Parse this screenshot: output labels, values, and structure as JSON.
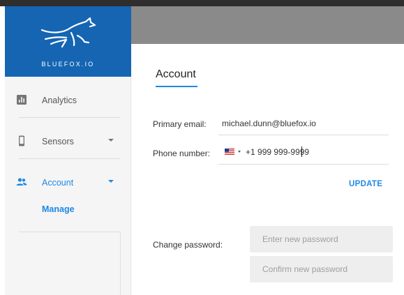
{
  "brand": {
    "name": "BLUEFOX.IO"
  },
  "sidebar": {
    "items": [
      {
        "label": "Analytics",
        "icon": "bar-chart-icon",
        "has_caret": false
      },
      {
        "label": "Sensors",
        "icon": "mobile-device-icon",
        "has_caret": true
      },
      {
        "label": "Account",
        "icon": "people-icon",
        "has_caret": true,
        "active": true
      }
    ],
    "sub_items": [
      {
        "label": "Manage",
        "active": true
      }
    ]
  },
  "main": {
    "title": "Account",
    "primary_email": {
      "label": "Primary email:",
      "value": "michael.dunn@bluefox.io"
    },
    "phone": {
      "label": "Phone number:",
      "country_flag": "us-flag-icon",
      "value": "+1 999 999-9999"
    },
    "update_label": "UPDATE",
    "change_password": {
      "label": "Change password:",
      "new_placeholder": "Enter new password",
      "confirm_placeholder": "Confirm new password"
    }
  },
  "colors": {
    "brand_blue": "#1565b3",
    "accent_blue": "#1e88e5",
    "header_gray": "#8a8a8a",
    "sidebar_bg": "#f5f5f5"
  }
}
